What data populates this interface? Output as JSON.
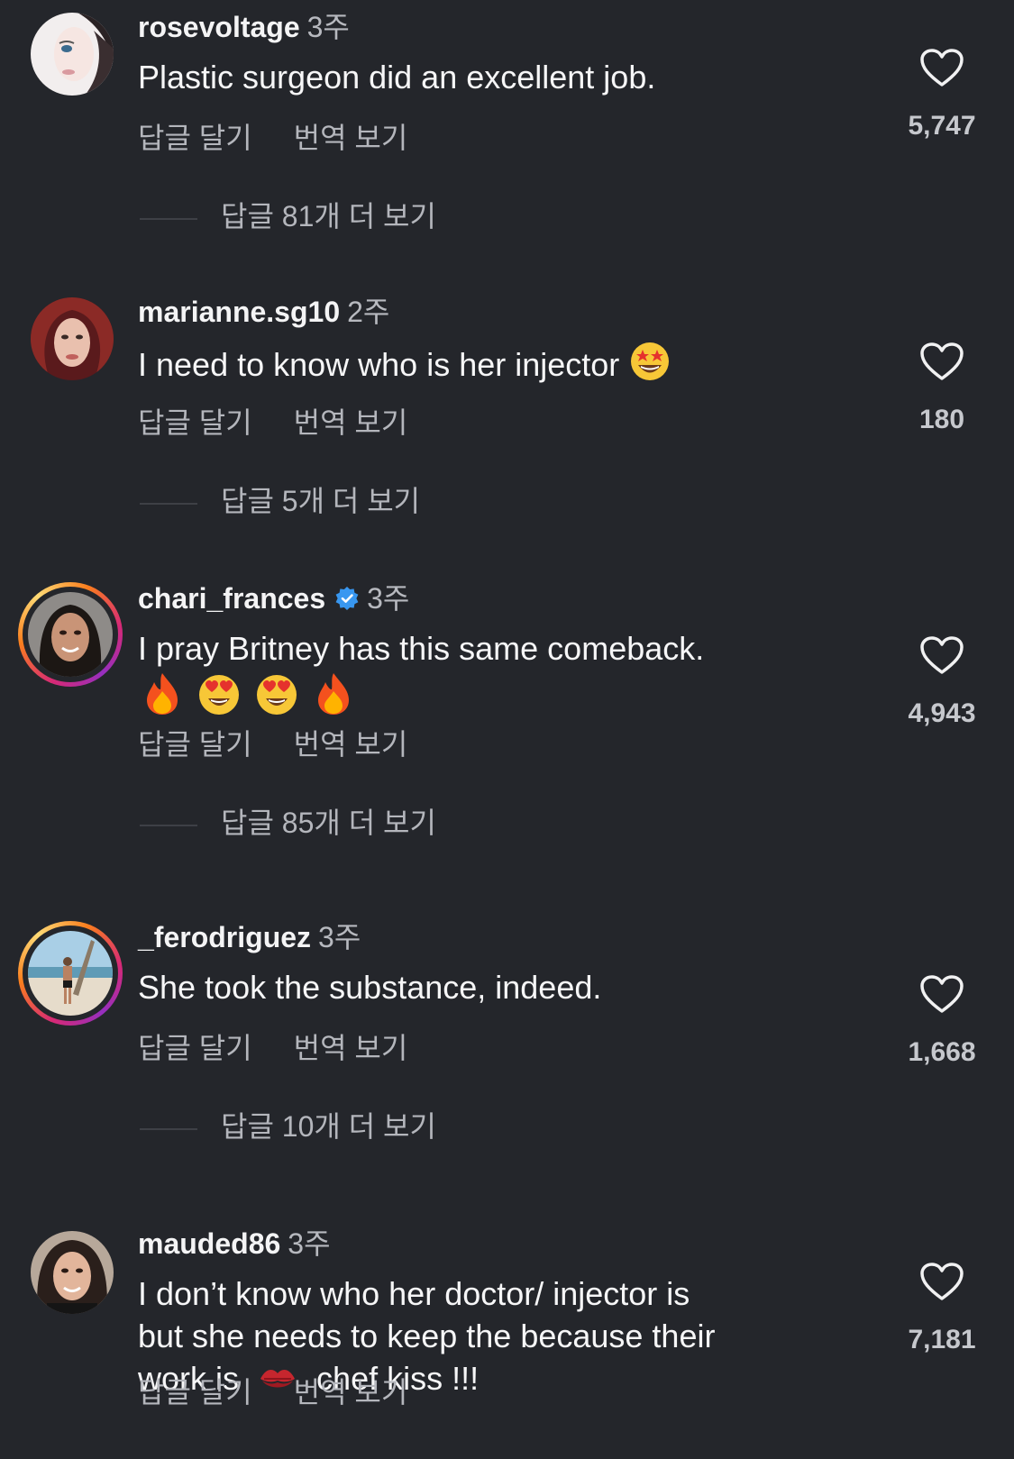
{
  "labels": {
    "reply": "답글 달기",
    "translate": "번역 보기"
  },
  "colors": {
    "background": "#24262b",
    "verified": "#3897f0",
    "story_ring": "#d62976"
  },
  "comments": [
    {
      "username": "rosevoltage",
      "age": "3주",
      "verified": false,
      "text": "Plastic surgeon did an excellent job.",
      "likes": "5,747",
      "more_replies": "답글 81개 더 보기"
    },
    {
      "username": "marianne.sg10",
      "age": "2주",
      "verified": false,
      "text": "I need to know who is her injector",
      "emoji": "star-struck-emoji",
      "likes": "180",
      "more_replies": "답글 5개 더 보기"
    },
    {
      "username": "chari_frances",
      "age": "3주",
      "verified": true,
      "text": "I pray Britney has this same comeback.",
      "emoji_line": [
        "fire-emoji",
        "heart-eyes-emoji",
        "heart-eyes-emoji",
        "fire-emoji"
      ],
      "likes": "4,943",
      "more_replies": "답글 85개 더 보기"
    },
    {
      "username": "_ferodriguez",
      "age": "3주",
      "verified": false,
      "text": "She took the substance, indeed.",
      "likes": "1,668",
      "more_replies": "답글 10개 더 보기"
    },
    {
      "username": "mauded86",
      "age": "3주",
      "verified": false,
      "text_line1": "I don’t know who her doctor/ injector is",
      "text_line2": "but she needs to keep the because their",
      "text_line3a": "work is",
      "text_line3b": "chef kiss !!!",
      "emoji": "kiss-mark-emoji",
      "likes": "7,181"
    }
  ]
}
